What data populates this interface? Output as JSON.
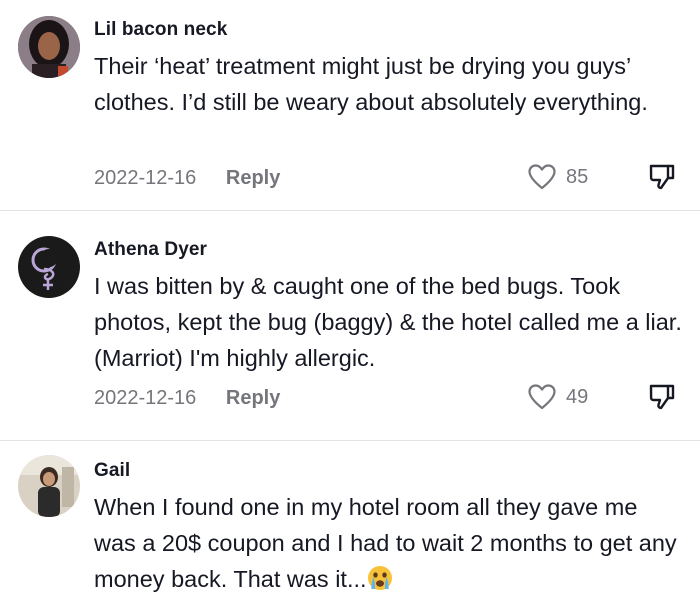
{
  "comments": [
    {
      "author": "Lil bacon neck",
      "text": "Their ‘heat’ treatment might just be drying you guys’ clothes. I’d still be weary about absolutely everything.",
      "date": "2022-12-16",
      "reply_label": "Reply",
      "likes": "85",
      "avatar_icon": "profile-photo-icon"
    },
    {
      "author": "Athena Dyer",
      "text": "I was bitten by & caught one of the bed bugs. Took photos, kept the bug (baggy) & the hotel called me a liar. (Marriot) I'm highly allergic.",
      "date": "2022-12-16",
      "reply_label": "Reply",
      "likes": "49",
      "avatar_icon": "moon-symbol-icon"
    },
    {
      "author": "Gail",
      "text": "When I found one in my hotel room all they gave me was a 20$ coupon and I had to wait 2 months to get any money back. That was it...",
      "emoji": "crying-face-emoji"
    }
  ],
  "colors": {
    "text": "#161823",
    "meta": "#75767b",
    "divider": "#e3e3e4"
  }
}
